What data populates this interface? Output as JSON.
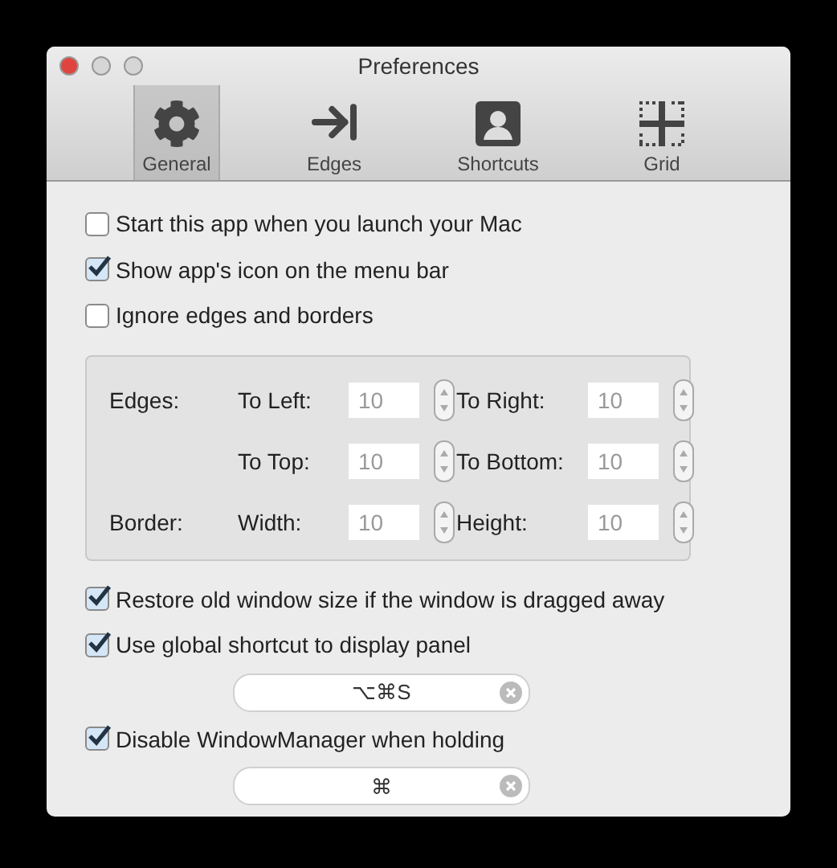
{
  "window": {
    "title": "Preferences"
  },
  "tabs": [
    {
      "label": "General",
      "selected": true
    },
    {
      "label": "Edges",
      "selected": false
    },
    {
      "label": "Shortcuts",
      "selected": false
    },
    {
      "label": "Grid",
      "selected": false
    }
  ],
  "options_top": [
    {
      "label": "Start this app when you launch your Mac",
      "checked": false
    },
    {
      "label": "Show app's icon on the menu bar",
      "checked": true
    },
    {
      "label": "Ignore edges and borders",
      "checked": false
    }
  ],
  "edges_box": {
    "disabled": true,
    "rows": [
      {
        "group": "Edges:",
        "fields": [
          {
            "label": "To Left:",
            "value": "10"
          },
          {
            "label": "To Right:",
            "value": "10"
          }
        ]
      },
      {
        "fields": [
          {
            "label": "To Top:",
            "value": "10"
          },
          {
            "label": "To Bottom:",
            "value": "10"
          }
        ]
      },
      {
        "group": "Border:",
        "fields": [
          {
            "label": "Width:",
            "value": "10"
          },
          {
            "label": "Height:",
            "value": "10"
          }
        ]
      }
    ]
  },
  "options_bottom": [
    {
      "kind": "checkbox",
      "label": "Restore old window size if the window is dragged away",
      "checked": true
    },
    {
      "kind": "checkbox",
      "label": "Use global shortcut to display panel",
      "checked": true
    },
    {
      "kind": "shortcut",
      "value": "⌥⌘S"
    },
    {
      "kind": "checkbox",
      "label": "Disable WindowManager when holding",
      "checked": true
    },
    {
      "kind": "shortcut",
      "value": "⌘"
    }
  ]
}
